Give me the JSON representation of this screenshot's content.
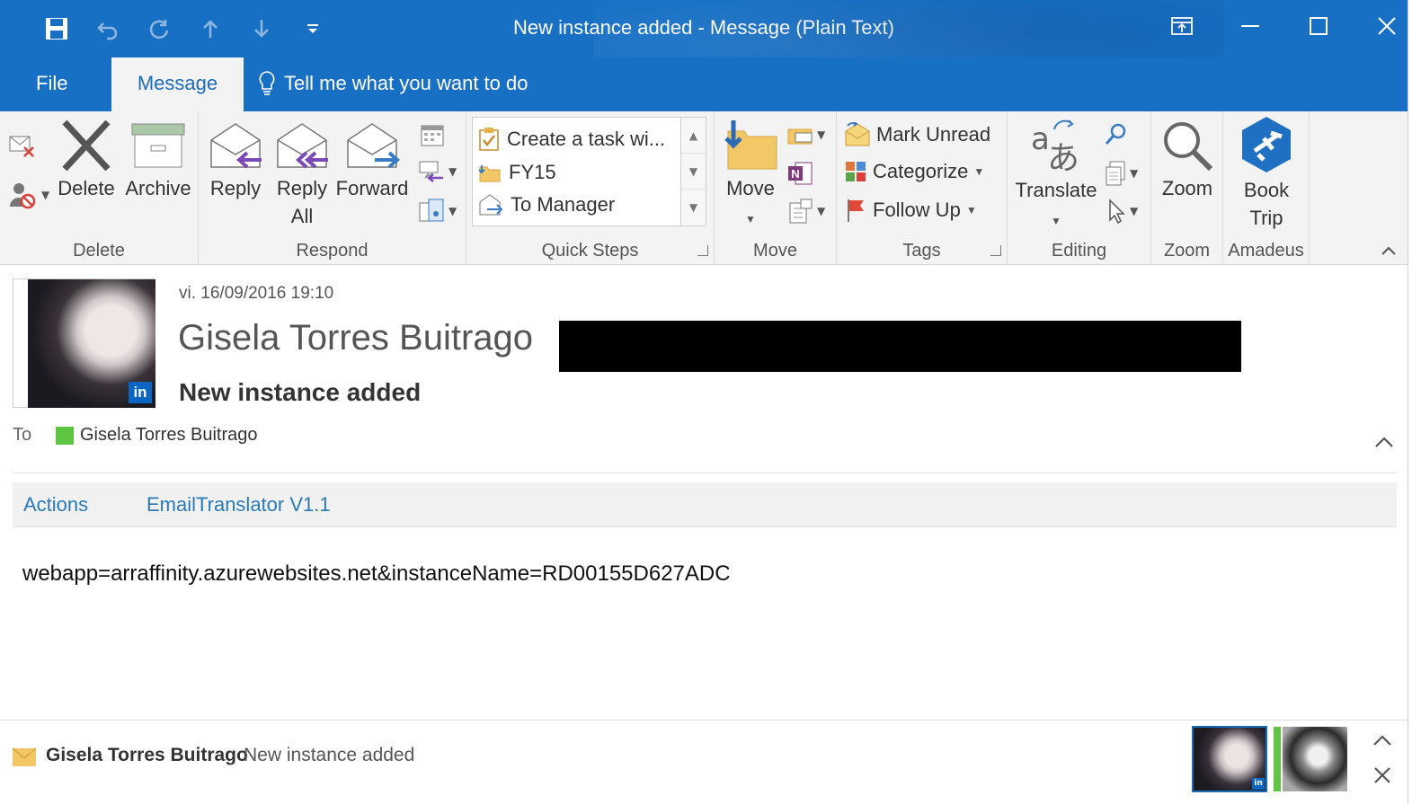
{
  "window": {
    "title": "New instance added - Message (Plain Text)"
  },
  "tabs": {
    "file": "File",
    "message": "Message",
    "tell_me": "Tell me what you want to do"
  },
  "ribbon": {
    "delete_group": {
      "label": "Delete",
      "delete": "Delete",
      "archive": "Archive"
    },
    "respond_group": {
      "label": "Respond",
      "reply": "Reply",
      "reply_all_1": "Reply",
      "reply_all_2": "All",
      "forward": "Forward"
    },
    "quick_steps_group": {
      "label": "Quick Steps",
      "items": [
        "Create a task wi...",
        "FY15",
        "To Manager"
      ]
    },
    "move_group": {
      "label": "Move",
      "move": "Move"
    },
    "tags_group": {
      "label": "Tags",
      "mark_unread": "Mark Unread",
      "categorize": "Categorize",
      "follow_up": "Follow Up"
    },
    "editing_group": {
      "label": "Editing",
      "translate": "Translate"
    },
    "zoom_group": {
      "label": "Zoom",
      "zoom": "Zoom"
    },
    "amadeus_group": {
      "label": "Amadeus",
      "book_1": "Book",
      "book_2": "Trip"
    }
  },
  "message": {
    "datetime": "vi. 16/09/2016 19:10",
    "sender": "Gisela Torres Buitrago",
    "subject": "New instance added",
    "to_label": "To",
    "to_name": "Gisela Torres Buitrago",
    "addins": [
      "Actions",
      "EmailTranslator V1.1"
    ],
    "body": "webapp=arraffinity.azurewebsites.net&instanceName=RD00155D627ADC"
  },
  "people_pane": {
    "name": "Gisela Torres Buitrago",
    "subject": "New instance added"
  },
  "colors": {
    "title_bar": "#1870c5",
    "ribbon_bg": "#f3f3f3",
    "accent_text": "#2a7ab8",
    "presence": "#5dc542"
  }
}
